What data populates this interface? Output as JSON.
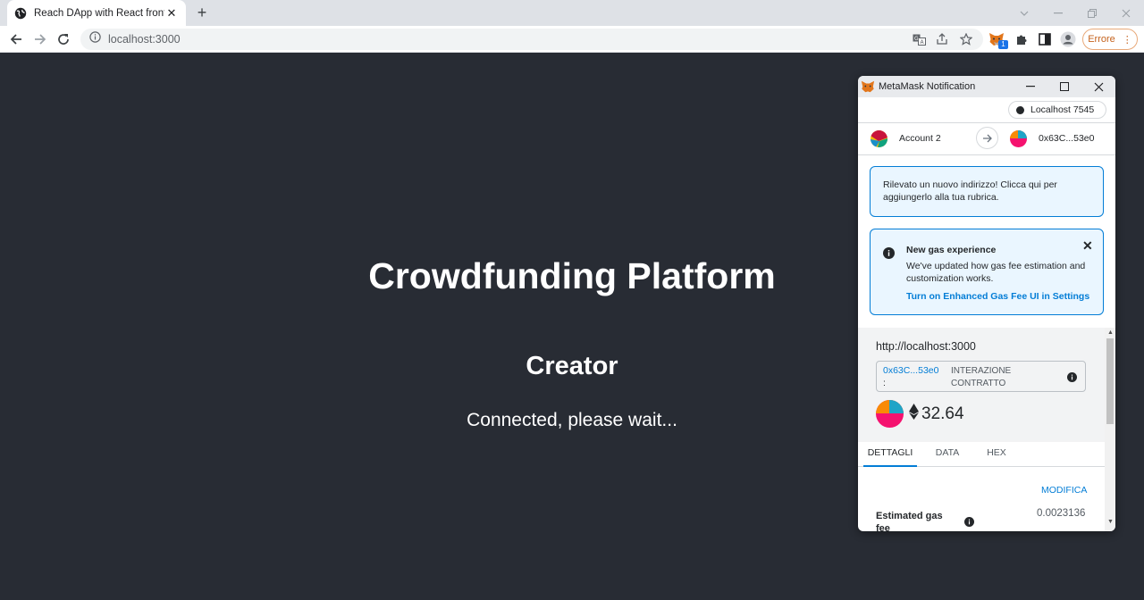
{
  "browser": {
    "tab_title": "Reach DApp with React frontend",
    "url": "localhost:3000",
    "profile_label": "Errore",
    "extension_badge": "1"
  },
  "page": {
    "title": "Crowdfunding Platform",
    "subtitle": "Creator",
    "status": "Connected, please wait..."
  },
  "metamask": {
    "window_title": "MetaMask Notification",
    "network": "Localhost 7545",
    "from_account": "Account 2",
    "to_address": "0x63C...53e0",
    "notice": "Rilevato un nuovo indirizzo! Clicca qui per aggiungerlo alla tua rubrica.",
    "gas_title": "New gas experience",
    "gas_body": "We've updated how gas fee estimation and customization works.",
    "gas_link": "Turn on Enhanced Gas Fee UI in Settings",
    "origin": "http://localhost:3000",
    "contract_address": "0x63C...53e0",
    "contract_colon": ":",
    "contract_kind": "INTERAZIONE CONTRATTO",
    "amount": "32.64",
    "tabs": [
      "DETTAGLI",
      "DATA",
      "HEX"
    ],
    "edit_label": "MODIFICA",
    "fee_label": "Estimated gas fee",
    "fee_value": "0.0023136"
  },
  "colors": {
    "page_bg": "#282c34",
    "metamask_blue": "#037dd6",
    "notice_bg": "#eaf6ff",
    "profile_orange": "#c5631e"
  },
  "icons": [
    "globe-icon",
    "close-icon",
    "plus-icon",
    "back-arrow-icon",
    "forward-arrow-icon",
    "reload-icon",
    "info-icon",
    "translate-icon",
    "share-icon",
    "star-icon",
    "metamask-fox-icon",
    "puzzle-icon",
    "sidepanel-icon",
    "person-icon",
    "kebab-icon",
    "minimize-icon",
    "maximize-icon",
    "arrow-right-icon",
    "ethereum-icon"
  ]
}
